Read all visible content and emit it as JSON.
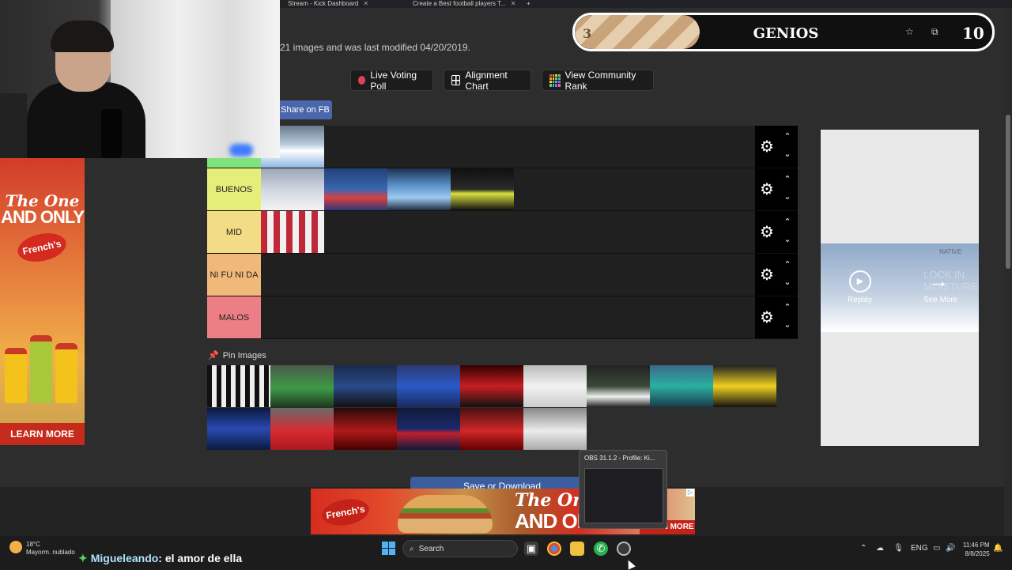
{
  "browser": {
    "tabs": [
      {
        "title": "Stream - Kick Dashboard"
      },
      {
        "title": "Create a Best football players T..."
      }
    ],
    "new_tab": "+"
  },
  "page": {
    "info_text": "21 images and was last modified 04/20/2019.",
    "buttons": {
      "live_voting": "Live Voting Poll",
      "alignment": "Alignment Chart",
      "community": "View Community Rank"
    },
    "share_fb": "Share on FB",
    "tiers": [
      {
        "label": "",
        "color": "#7fe37b",
        "images": 1
      },
      {
        "label": "BUENOS",
        "color": "#e6ee7a",
        "images": 4
      },
      {
        "label": "MID",
        "color": "#f2dd86",
        "images": 1
      },
      {
        "label": "NI FU NI DA",
        "color": "#f0b97a",
        "images": 0
      },
      {
        "label": "MALOS",
        "color": "#ec7e85",
        "images": 0
      }
    ],
    "pin_images_label": "Pin Images",
    "pool_count": 16,
    "save_download": "Save or Download"
  },
  "overlay": {
    "left_value": "3",
    "title": "GENIOS",
    "right_value": "10",
    "progress": 0.3
  },
  "ads": {
    "left": {
      "line1": "The One",
      "line2": "AND ONLY",
      "brand": "French's",
      "cta": "LEARN MORE"
    },
    "right": {
      "brand": "NATIVE",
      "headline": "LOCK IN MOISTURE",
      "replay": "Replay",
      "see_more": "See More"
    },
    "bottom": {
      "line1": "The One",
      "line2": "AND ONLY",
      "brand": "French's",
      "cta": "LEARN MORE"
    }
  },
  "obs_popup": {
    "title": "OBS 31.1.2 - Profile: Ki..."
  },
  "taskbar": {
    "weather_temp": "18°C",
    "weather_desc": "Mayorm. nublado",
    "search_label": "Search",
    "language": "ENG",
    "time": "11:46 PM",
    "date": "8/8/2025"
  },
  "chat": {
    "username": "Migueleando",
    "message": ": el amor de ella"
  }
}
